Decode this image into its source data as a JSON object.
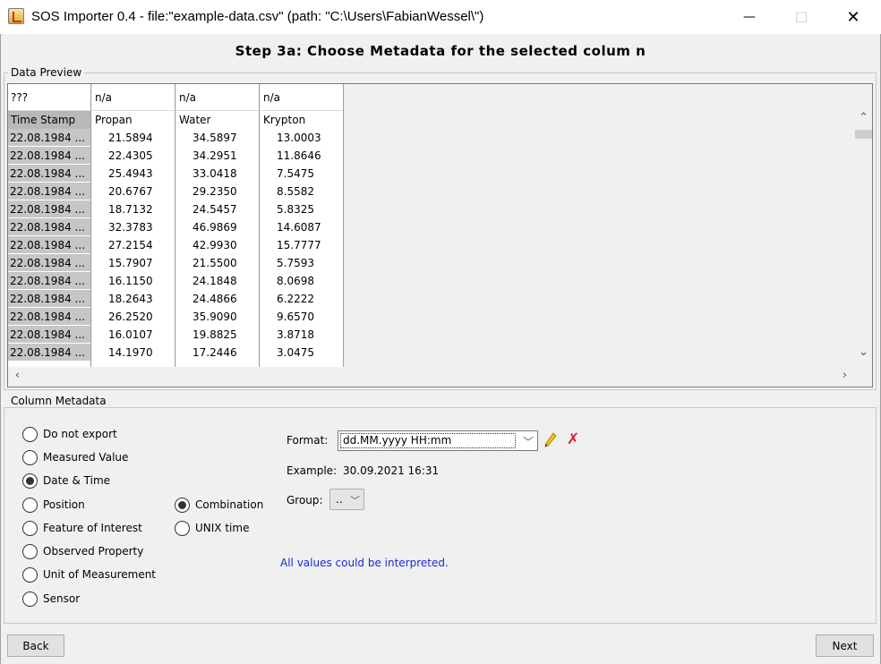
{
  "window": {
    "title": "SOS Importer 0.4 - file:\"example-data.csv\" (path: \"C:\\Users\\FabianWessel\\\")",
    "minimize": "—",
    "maximize": "☐",
    "close": "✕"
  },
  "step_title": "Step 3a: Choose Metadata for the selected colum n",
  "data_preview": {
    "legend": "Data Preview",
    "columns": [
      {
        "type": "???",
        "header": "Time Stamp"
      },
      {
        "type": "n/a",
        "header": "Propan"
      },
      {
        "type": "n/a",
        "header": "Water"
      },
      {
        "type": "n/a",
        "header": "Krypton"
      }
    ],
    "rows": [
      [
        "22.08.1984 ...",
        "21.5894",
        "34.5897",
        "13.0003"
      ],
      [
        "22.08.1984 ...",
        "22.4305",
        "34.2951",
        "11.8646"
      ],
      [
        "22.08.1984 ...",
        "25.4943",
        "33.0418",
        "7.5475"
      ],
      [
        "22.08.1984 ...",
        "20.6767",
        "29.2350",
        "8.5582"
      ],
      [
        "22.08.1984 ...",
        "18.7132",
        "24.5457",
        "5.8325"
      ],
      [
        "22.08.1984 ...",
        "32.3783",
        "46.9869",
        "14.6087"
      ],
      [
        "22.08.1984 ...",
        "27.2154",
        "42.9930",
        "15.7777"
      ],
      [
        "22.08.1984 ...",
        "15.7907",
        "21.5500",
        "5.7593"
      ],
      [
        "22.08.1984 ...",
        "16.1150",
        "24.1848",
        "8.0698"
      ],
      [
        "22.08.1984 ...",
        "18.2643",
        "24.4866",
        "6.2222"
      ],
      [
        "22.08.1984 ...",
        "26.2520",
        "35.9090",
        "9.6570"
      ],
      [
        "22.08.1984 ...",
        "16.0107",
        "19.8825",
        "3.8718"
      ],
      [
        "22.08.1984 ...",
        "14.1970",
        "17.2446",
        "3.0475"
      ]
    ]
  },
  "metadata": {
    "legend": "Column Metadata",
    "types": [
      {
        "label": "Do not export",
        "selected": false
      },
      {
        "label": "Measured Value",
        "selected": false
      },
      {
        "label": "Date & Time",
        "selected": true
      },
      {
        "label": "Position",
        "selected": false
      },
      {
        "label": "Feature of Interest",
        "selected": false
      },
      {
        "label": "Observed Property",
        "selected": false
      },
      {
        "label": "Unit of Measurement",
        "selected": false
      },
      {
        "label": "Sensor",
        "selected": false
      }
    ],
    "datetime_modes": [
      {
        "label": "Combination",
        "selected": true
      },
      {
        "label": "UNIX time",
        "selected": false
      }
    ],
    "format_label": "Format:",
    "format_value": "dd.MM.yyyy HH:mm",
    "example_label": "Example:",
    "example_value": "30.09.2021 16:31",
    "group_label": "Group:",
    "group_value": "..",
    "status": "All values could be interpreted."
  },
  "buttons": {
    "back": "Back",
    "next": "Next"
  }
}
